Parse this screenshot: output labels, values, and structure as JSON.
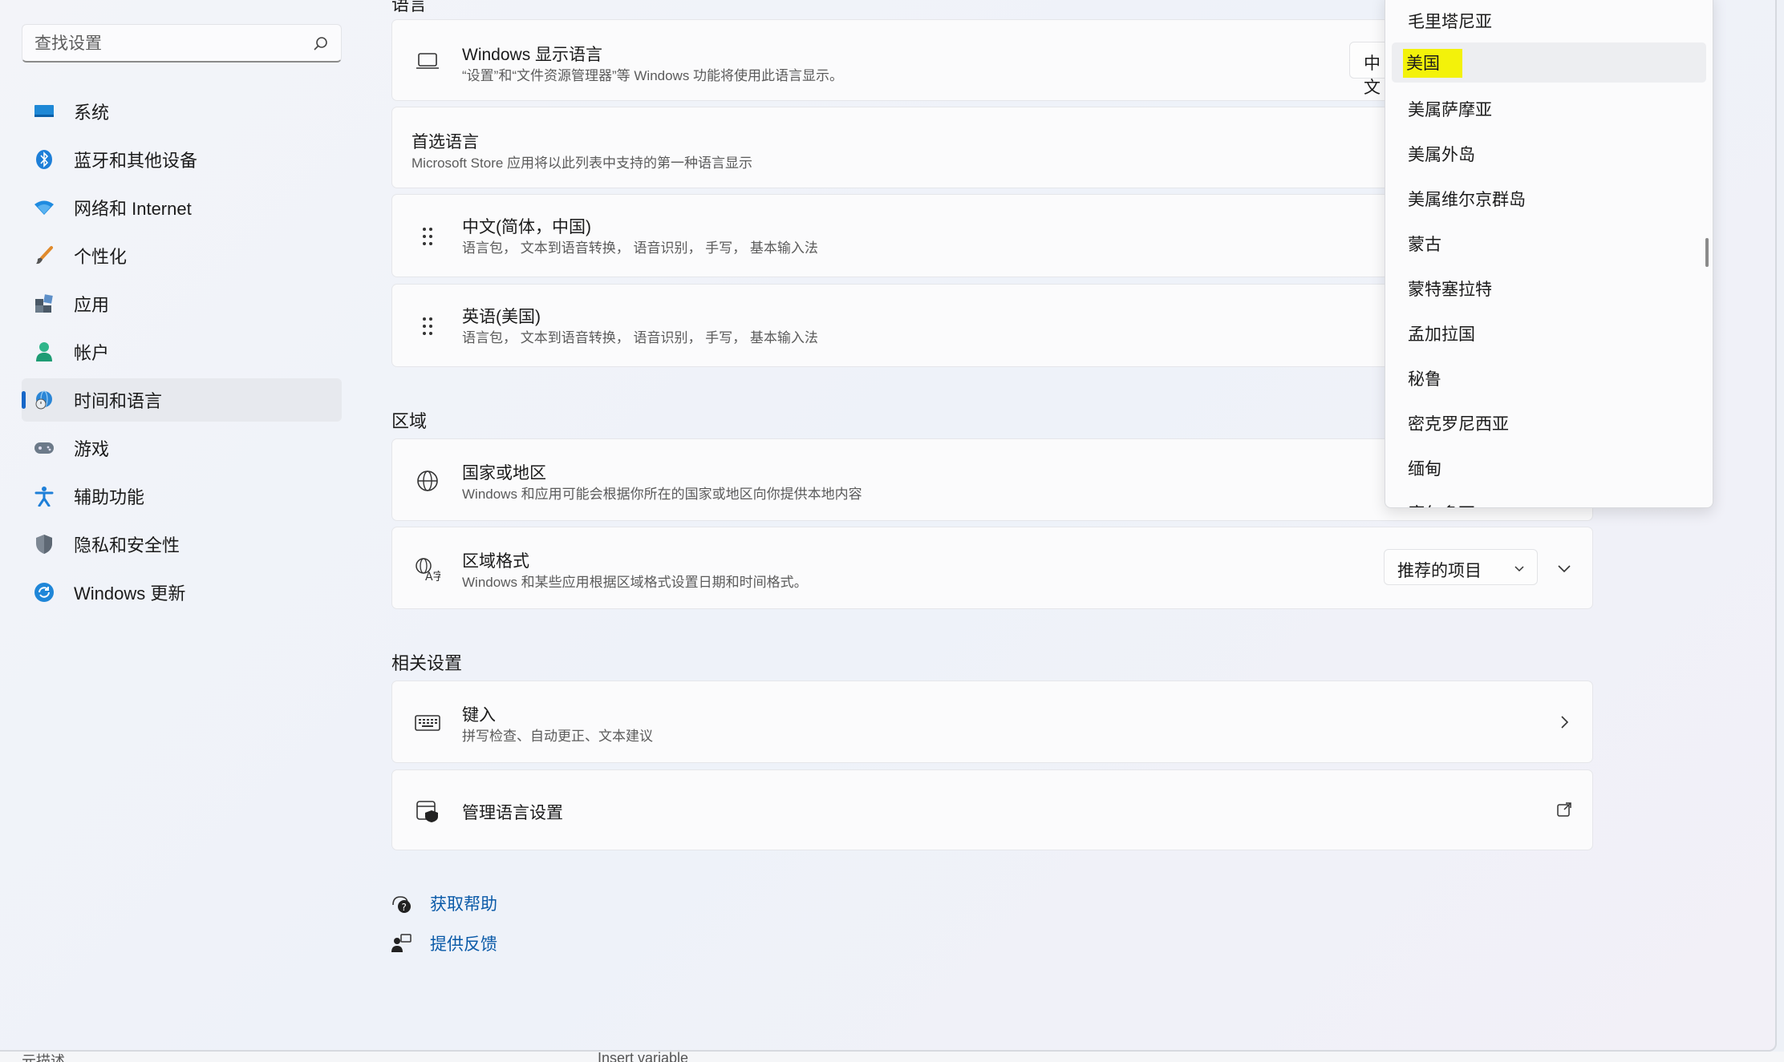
{
  "search": {
    "placeholder": "查找设置"
  },
  "sidebar": {
    "items": [
      {
        "label": "系统",
        "icon": "display-icon"
      },
      {
        "label": "蓝牙和其他设备",
        "icon": "bluetooth-icon"
      },
      {
        "label": "网络和 Internet",
        "icon": "wifi-icon"
      },
      {
        "label": "个性化",
        "icon": "brush-icon"
      },
      {
        "label": "应用",
        "icon": "apps-icon"
      },
      {
        "label": "帐户",
        "icon": "person-icon"
      },
      {
        "label": "时间和语言",
        "icon": "globe-clock-icon",
        "active": true
      },
      {
        "label": "游戏",
        "icon": "gamepad-icon"
      },
      {
        "label": "辅助功能",
        "icon": "accessibility-icon"
      },
      {
        "label": "隐私和安全性",
        "icon": "shield-icon"
      },
      {
        "label": "Windows 更新",
        "icon": "update-icon"
      }
    ]
  },
  "language": {
    "section_title": "语言",
    "display_language": {
      "title": "Windows 显示语言",
      "subtitle": "“设置”和“文件资源管理器”等 Windows 功能将使用此语言显示。",
      "value": "中文"
    },
    "preferred": {
      "title": "首选语言",
      "subtitle": "Microsoft Store 应用将以此列表中支持的第一种语言显示"
    },
    "languages": [
      {
        "title": "中文(简体，中国)",
        "subtitle": "语言包，  文本到语音转换，  语音识别，  手写，  基本输入法"
      },
      {
        "title": "英语(美国)",
        "subtitle": "语言包，  文本到语音转换，  语音识别，  手写，  基本输入法"
      }
    ]
  },
  "region": {
    "section_title": "区域",
    "country": {
      "title": "国家或地区",
      "subtitle": "Windows 和应用可能会根据你所在的国家或地区向你提供本地内容"
    },
    "format": {
      "title": "区域格式",
      "subtitle": "Windows 和某些应用根据区域格式设置日期和时间格式。",
      "dropdown_value": "推荐的项目"
    }
  },
  "related": {
    "section_title": "相关设置",
    "typing": {
      "title": "键入",
      "subtitle": "拼写检查、自动更正、文本建议"
    },
    "manage": {
      "title": "管理语言设置"
    }
  },
  "links": {
    "help": "获取帮助",
    "feedback": "提供反馈"
  },
  "country_popup": {
    "items": [
      "毛里塔尼亚",
      "美国",
      "美属萨摩亚",
      "美属外岛",
      "美属维尔京群岛",
      "蒙古",
      "蒙特塞拉特",
      "孟加拉国",
      "秘鲁",
      "密克罗尼西亚",
      "缅甸",
      "摩尔多瓦"
    ],
    "selected_index": 1,
    "highlight_color": "#f3f20a"
  },
  "bottom_strip": {
    "left_text": "元描述",
    "right_text": "Insert variable"
  },
  "colors": {
    "accent": "#1767c8",
    "link": "#0a5aa8"
  }
}
